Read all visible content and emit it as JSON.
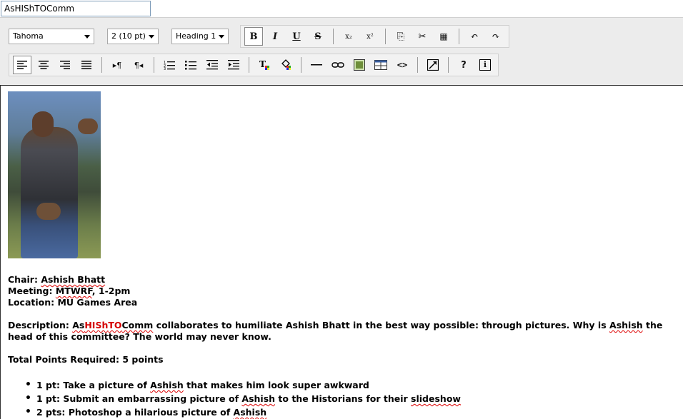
{
  "title_input": {
    "value": "AsHIShTOComm"
  },
  "toolbar": {
    "font_select": "Tahoma",
    "size_select": "2 (10 pt)",
    "style_select": "Heading 1",
    "row1_buttons": [
      {
        "name": "bold-button",
        "glyph": "B"
      },
      {
        "name": "italic-button",
        "glyph": "I"
      },
      {
        "name": "underline-button",
        "glyph": "U"
      },
      {
        "name": "strikethrough-button",
        "glyph": "S"
      }
    ],
    "icons": {
      "subscript": "x₂",
      "superscript": "x²",
      "copy": "⎘",
      "cut": "✂",
      "paste": "📋",
      "undo": "↶",
      "redo": "↷",
      "align_left": "≡",
      "align_center": "≡",
      "align_right": "≡",
      "justify": "≣",
      "ltr": "▸¶",
      "rtl": "¶◂",
      "ordered_list": "⒈",
      "bullet_list": "☰",
      "outdent": "⇤",
      "indent": "⇥",
      "text_color": "T",
      "bg_color": "◈",
      "hr": "—",
      "link": "⊂⊃",
      "image": "▣",
      "table": "▤",
      "source": "<>",
      "fullscreen": "⤢",
      "help": "?",
      "info": "i"
    }
  },
  "content": {
    "chair_label": "Chair: ",
    "chair_name": "Ashish Bhatt",
    "meeting_label": "Meeting: ",
    "meeting_days": "MTWRF",
    "meeting_time": ", 1-2pm",
    "location": "Location: MU Games Area",
    "desc_prefix": "Description: ",
    "desc_as": "As",
    "desc_his": "HISh",
    "desc_to": "TO",
    "desc_comm": "Comm",
    "desc_mid": " collaborates to humiliate Ashish Bhatt in the best way possible: through pictures. Why is ",
    "desc_ashish": "Ashish",
    "desc_end": " the head of this committee? The world may never know.",
    "total_points": "Total Points Required: 5 points",
    "item1_pre": "1 pt: Take a picture of ",
    "item1_name": "Ashish",
    "item1_post": " that makes him look super awkward",
    "item2_pre": "1 pt: Submit an embarrassing picture of ",
    "item2_name": "Ashish",
    "item2_mid": " to the Historians for their ",
    "item2_word": "slideshow",
    "item3_pre": "2 pts: Photoshop a hilarious picture of ",
    "item3_name": "Ashish"
  }
}
